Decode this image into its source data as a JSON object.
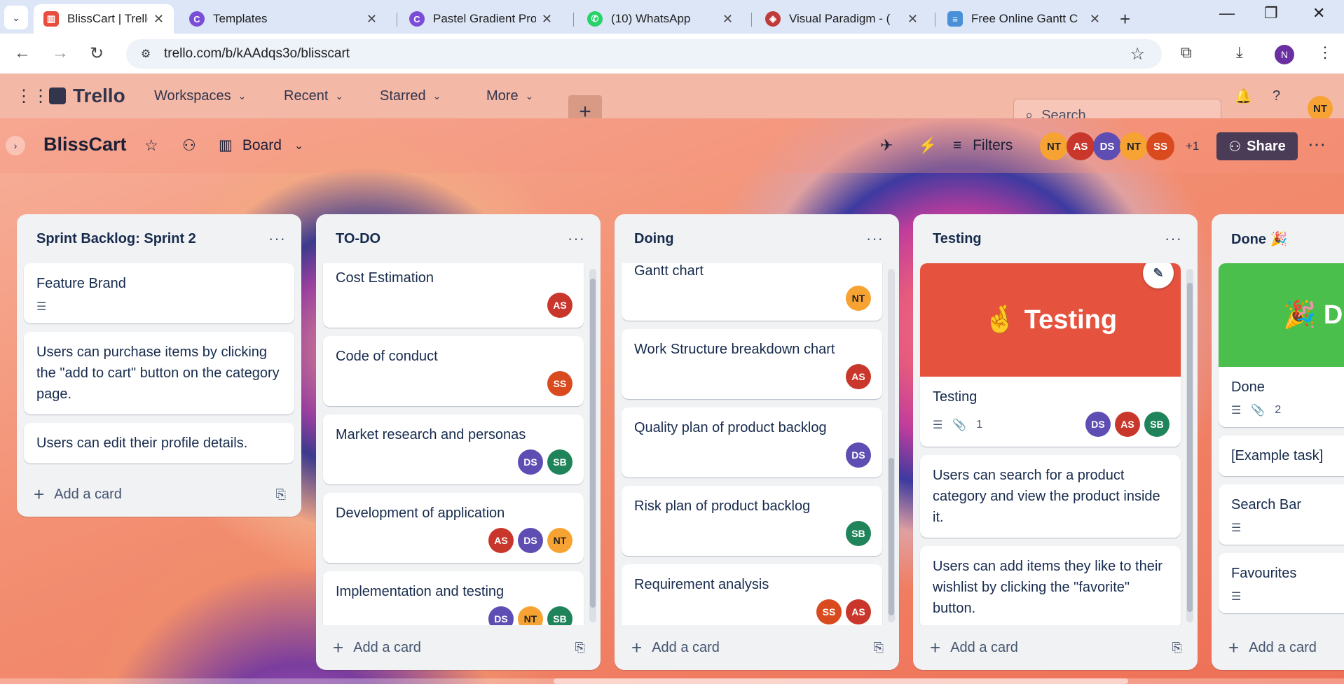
{
  "browser": {
    "tabs": [
      {
        "label": "BlissCart | Trello",
        "color": "#e84d3d",
        "icon": "trello-icon"
      },
      {
        "label": "Templates",
        "color": "#7b4dd6",
        "icon": "canva-icon"
      },
      {
        "label": "Pastel Gradient Pro",
        "color": "#7b4dd6",
        "icon": "canva-icon"
      },
      {
        "label": "(10) WhatsApp",
        "color": "#25d366",
        "icon": "whatsapp-icon"
      },
      {
        "label": "Visual Paradigm - (",
        "color": "#c03a3a",
        "icon": "visual-paradigm-icon"
      },
      {
        "label": "Free Online Gantt C",
        "color": "#4a90d9",
        "icon": "gantt-icon"
      }
    ],
    "url": "trello.com/b/kAAdqs3o/blisscart",
    "profile": "N"
  },
  "header": {
    "logo": "Trello",
    "nav": [
      "Workspaces",
      "Recent",
      "Starred",
      "More"
    ],
    "search_placeholder": "Search",
    "user": "NT"
  },
  "board": {
    "title": "BlissCart",
    "view": "Board",
    "filters": "Filters",
    "members": [
      {
        "initials": "NT",
        "color": "#f7a333"
      },
      {
        "initials": "AS",
        "color": "#c9372c"
      },
      {
        "initials": "DS",
        "color": "#5e4db2"
      },
      {
        "initials": "NT",
        "color": "#f7a333"
      },
      {
        "initials": "SS",
        "color": "#d94a1e"
      }
    ],
    "extra_members": "+1",
    "share": "Share"
  },
  "add_card_label": "Add a card",
  "lists": [
    {
      "title": "Sprint Backlog: Sprint 2",
      "cards": [
        {
          "text": "Feature Brand",
          "desc": true
        },
        {
          "text": "Users can purchase items by clicking the \"add to cart\" button on the category page."
        },
        {
          "text": "Users can edit their profile details."
        }
      ]
    },
    {
      "title": "TO-DO",
      "cards": [
        {
          "text": "Cost Estimation",
          "members": [
            "AS"
          ]
        },
        {
          "text": "Code of conduct",
          "members": [
            "SS"
          ]
        },
        {
          "text": "Market research and personas",
          "members": [
            "DS",
            "SB"
          ]
        },
        {
          "text": "Development of application",
          "members": [
            "AS",
            "DS",
            "NT"
          ]
        },
        {
          "text": "Implementation and testing",
          "members": [
            "DS",
            "NT",
            "SB"
          ]
        }
      ]
    },
    {
      "title": "Doing",
      "cards": [
        {
          "text": "Gantt chart",
          "members": [
            "NT"
          ]
        },
        {
          "text": "Work Structure breakdown chart",
          "members": [
            "AS"
          ]
        },
        {
          "text": "Quality plan of product backlog",
          "members": [
            "DS"
          ]
        },
        {
          "text": "Risk plan of product backlog",
          "members": [
            "SB"
          ]
        },
        {
          "text": "Requirement analysis",
          "members": [
            "SS",
            "AS"
          ]
        }
      ]
    },
    {
      "title": "Testing",
      "cover": {
        "text": "🤞 Testing",
        "color": "#e5533f"
      },
      "cards": [
        {
          "text": "Testing",
          "attachments": "1",
          "members": [
            "DS",
            "AS",
            "SB"
          ]
        },
        {
          "text": "Users can search for a product category and view the product inside it."
        },
        {
          "text": "Users can add items they like to their wishlist by clicking the \"favorite\" button."
        }
      ]
    },
    {
      "title": "Done 🎉",
      "cover": {
        "text": "🎉 D",
        "color": "#4bbf4b"
      },
      "cards": [
        {
          "text": "Done",
          "attachments": "2"
        },
        {
          "text": "[Example task]"
        },
        {
          "text": "Search Bar"
        },
        {
          "text": "Favourites"
        }
      ]
    }
  ]
}
